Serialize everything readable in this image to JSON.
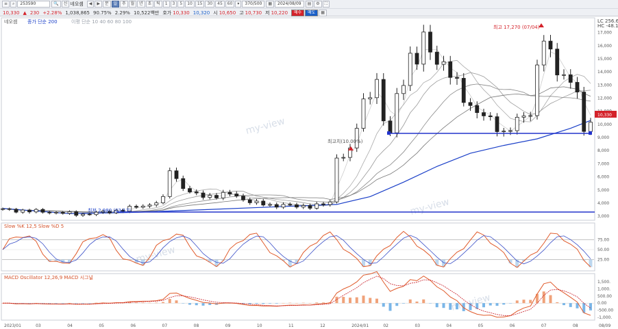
{
  "toolbar": {
    "code": "253590",
    "stock_name": "네오셈",
    "name_tag": "신",
    "periods": [
      "분",
      "일",
      "주",
      "월",
      "년",
      "초",
      "틱"
    ],
    "period_numbers": [
      "1",
      "3",
      "5",
      "10",
      "15",
      "30",
      "45",
      "60"
    ],
    "count": "370/500",
    "date": "2024/08/09",
    "price": "10,330",
    "change": "230",
    "change_pct": "+2.28%",
    "volume": "1,038,865",
    "vol_ratio": "90.75%",
    "turnover": "2.29%",
    "amount": "10,522백만",
    "quote_label": "호가",
    "quote_values": [
      "10,330",
      "10,320"
    ],
    "open_label": "시",
    "open_value": "10,650",
    "high_label": "고",
    "high_value": "10,730",
    "low_label": "저",
    "low_value": "10,220",
    "buy_label": "매수",
    "sell_label": "매도",
    "colors": {
      "up": "#d4222a",
      "down": "#1a5fc8",
      "buy": "#d4222a",
      "sell": "#1a5fc8"
    }
  },
  "price_panel": {
    "legend": [
      "네오셈",
      "종가 단순 200",
      "이평 단순 10 40 60 80 100"
    ],
    "right_top": [
      "LC 256.65",
      "HC -48.10"
    ],
    "y_ticks": [
      "17,000",
      "16,000",
      "15,000",
      "14,000",
      "13,000",
      "12,000",
      "11,000",
      "10,000",
      "9,000",
      "8,000",
      "7,000",
      "6,000",
      "5,000",
      "4,000",
      "3,000"
    ],
    "current_price": "10,330",
    "annotations": {
      "high": "최고 17,270 (07/04)",
      "low": "최저 2,980 (03/17)",
      "mid": "최고치(10.00%)"
    },
    "watermark": "my-view"
  },
  "slow_panel": {
    "legend": "Slow %K 12,5 Slow %D 5",
    "y_ticks": [
      "75.00",
      "50.00",
      "25.00"
    ]
  },
  "macd_panel": {
    "legend": "MACD Oscillator 12,26,9 MACD 시그널",
    "y_ticks": [
      "1,500.",
      "1,000.",
      "500.00",
      "0.00",
      "-500.00",
      "-1,000."
    ]
  },
  "x_axis": [
    "2023/01",
    "03",
    "04",
    "05",
    "06",
    "07",
    "08",
    "09",
    "10",
    "11",
    "12",
    "2024/01",
    "02",
    "03",
    "04",
    "05",
    "06",
    "07",
    "08",
    "08/09"
  ],
  "chart_data": {
    "type": "candlestick",
    "x_axis_labels": [
      "2023/01",
      "03",
      "04",
      "05",
      "06",
      "07",
      "08",
      "09",
      "10",
      "11",
      "12",
      "2024/01",
      "02",
      "03",
      "04",
      "05",
      "06",
      "07",
      "08"
    ],
    "y_range": [
      2800,
      17500
    ],
    "close_path": [
      [
        0,
        3500
      ],
      [
        2,
        3450
      ],
      [
        4,
        3400
      ],
      [
        6,
        3350
      ],
      [
        8,
        3300
      ],
      [
        10,
        3200
      ],
      [
        12,
        3150
      ],
      [
        14,
        3250
      ],
      [
        16,
        3350
      ],
      [
        18,
        3500
      ],
      [
        20,
        3700
      ],
      [
        22,
        3900
      ],
      [
        24,
        4300
      ],
      [
        25,
        6600
      ],
      [
        26,
        5800
      ],
      [
        28,
        4800
      ],
      [
        30,
        4500
      ],
      [
        32,
        4600
      ],
      [
        34,
        4700
      ],
      [
        35,
        4500
      ],
      [
        36,
        4300
      ],
      [
        38,
        4000
      ],
      [
        40,
        3800
      ],
      [
        42,
        3900
      ],
      [
        44,
        3700
      ],
      [
        46,
        3800
      ],
      [
        48,
        3900
      ],
      [
        49,
        4000
      ],
      [
        50,
        7500
      ],
      [
        52,
        8000
      ],
      [
        53,
        9800
      ],
      [
        54,
        11500
      ],
      [
        56,
        13500
      ],
      [
        57,
        10200
      ],
      [
        58,
        9300
      ],
      [
        59,
        12000
      ],
      [
        61,
        15200
      ],
      [
        62,
        14800
      ],
      [
        63,
        16500
      ],
      [
        64,
        15500
      ],
      [
        66,
        14600
      ],
      [
        67,
        13800
      ],
      [
        69,
        12000
      ],
      [
        71,
        11000
      ],
      [
        73,
        10200
      ],
      [
        75,
        9400
      ],
      [
        77,
        10200
      ],
      [
        79,
        10900
      ],
      [
        80,
        14500
      ],
      [
        81,
        16800
      ],
      [
        82,
        15000
      ],
      [
        83,
        14000
      ],
      [
        85,
        13500
      ],
      [
        86,
        12500
      ],
      [
        87,
        9100
      ],
      [
        88,
        10400
      ]
    ],
    "ma200_path": [
      [
        0,
        3600
      ],
      [
        10,
        3200
      ],
      [
        20,
        3300
      ],
      [
        30,
        3500
      ],
      [
        40,
        3700
      ],
      [
        50,
        3900
      ],
      [
        55,
        4500
      ],
      [
        60,
        5600
      ],
      [
        65,
        6800
      ],
      [
        70,
        7800
      ],
      [
        75,
        8400
      ],
      [
        80,
        8900
      ],
      [
        85,
        9700
      ],
      [
        88,
        10300
      ]
    ],
    "support_level": 8900,
    "base_level": 2980
  }
}
